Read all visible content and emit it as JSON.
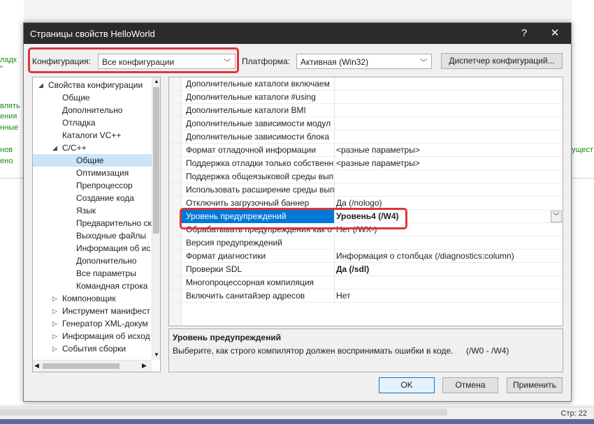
{
  "background": {
    "left_fragments": [
      "ладк",
      "\"",
      "влять",
      "ения",
      "нные",
      "нов",
      "ено"
    ],
    "right_fragments": [
      "ущест"
    ],
    "status_text": "Стр: 22"
  },
  "dialog": {
    "title": "Страницы свойств HelloWorld",
    "help_label": "?",
    "close_label": "✕",
    "configuration_label": "Конфигурация:",
    "configuration_value": "Все конфигурации",
    "platform_label": "Платформа:",
    "platform_value": "Активная (Win32)",
    "config_manager_label": "Диспетчер конфигураций...",
    "ok_label": "OK",
    "cancel_label": "Отмена",
    "apply_label": "Применить"
  },
  "tree": [
    {
      "label": "Свойства конфигурации",
      "level": 0,
      "expander": "open"
    },
    {
      "label": "Общие",
      "level": 1,
      "expander": "none"
    },
    {
      "label": "Дополнительно",
      "level": 1,
      "expander": "none"
    },
    {
      "label": "Отладка",
      "level": 1,
      "expander": "none"
    },
    {
      "label": "Каталоги VC++",
      "level": 1,
      "expander": "none"
    },
    {
      "label": "C/C++",
      "level": 1,
      "expander": "open"
    },
    {
      "label": "Общие",
      "level": 2,
      "expander": "none",
      "selected": true
    },
    {
      "label": "Оптимизация",
      "level": 2,
      "expander": "none"
    },
    {
      "label": "Препроцессор",
      "level": 2,
      "expander": "none"
    },
    {
      "label": "Создание кода",
      "level": 2,
      "expander": "none"
    },
    {
      "label": "Язык",
      "level": 2,
      "expander": "none"
    },
    {
      "label": "Предварительно ск",
      "level": 2,
      "expander": "none"
    },
    {
      "label": "Выходные файлы",
      "level": 2,
      "expander": "none"
    },
    {
      "label": "Информация об ис",
      "level": 2,
      "expander": "none"
    },
    {
      "label": "Дополнительно",
      "level": 2,
      "expander": "none"
    },
    {
      "label": "Все параметры",
      "level": 2,
      "expander": "none"
    },
    {
      "label": "Командная строка",
      "level": 2,
      "expander": "none"
    },
    {
      "label": "Компоновщик",
      "level": 1,
      "expander": "closed"
    },
    {
      "label": "Инструмент манифест",
      "level": 1,
      "expander": "closed"
    },
    {
      "label": "Генератор XML-докум",
      "level": 1,
      "expander": "closed"
    },
    {
      "label": "Информация об исход",
      "level": 1,
      "expander": "closed"
    },
    {
      "label": "События сборки",
      "level": 1,
      "expander": "closed"
    }
  ],
  "grid": [
    {
      "name": "Дополнительные каталоги включаем",
      "value": "",
      "bold": false
    },
    {
      "name": "Дополнительные каталоги #using",
      "value": "",
      "bold": false
    },
    {
      "name": "Дополнительные каталоги BMI",
      "value": "",
      "bold": false
    },
    {
      "name": "Дополнительные зависимости модул",
      "value": "",
      "bold": false
    },
    {
      "name": "Дополнительные зависимости блока",
      "value": "",
      "bold": false
    },
    {
      "name": "Формат отладочной информации",
      "value": "<разные параметры>",
      "bold": false
    },
    {
      "name": "Поддержка отладки только собственн",
      "value": "<разные параметры>",
      "bold": false
    },
    {
      "name": "Поддержка общеязыковой среды вып",
      "value": "",
      "bold": false
    },
    {
      "name": "Использовать расширение среды вып",
      "value": "",
      "bold": false
    },
    {
      "name": "Отключить загрузочный баннер",
      "value": "Да (/nologo)",
      "bold": false
    },
    {
      "name": "Уровень предупреждений",
      "value": "Уровень4 (/W4)",
      "bold": true,
      "selected": true
    },
    {
      "name": "Обрабатывать предупреждения как о",
      "value": "Нет (/WX-)",
      "bold": false
    },
    {
      "name": "Версия предупреждений",
      "value": "",
      "bold": false
    },
    {
      "name": "Формат диагностики",
      "value": "Информация о столбцах (/diagnostics:column)",
      "bold": false
    },
    {
      "name": "Проверки SDL",
      "value": "Да (/sdl)",
      "bold": true
    },
    {
      "name": "Многопроцессорная компиляция",
      "value": "",
      "bold": false
    },
    {
      "name": "Включить санитайзер адресов",
      "value": "Нет",
      "bold": false
    }
  ],
  "description": {
    "title": "Уровень предупреждений",
    "text": "Выберите, как строго компилятор должен воспринимать ошибки в коде.",
    "range": "(/W0 - /W4)"
  },
  "colors": {
    "selection": "#0078d7",
    "highlight_box": "#e0333a",
    "tree_selection": "#cce4f7"
  }
}
